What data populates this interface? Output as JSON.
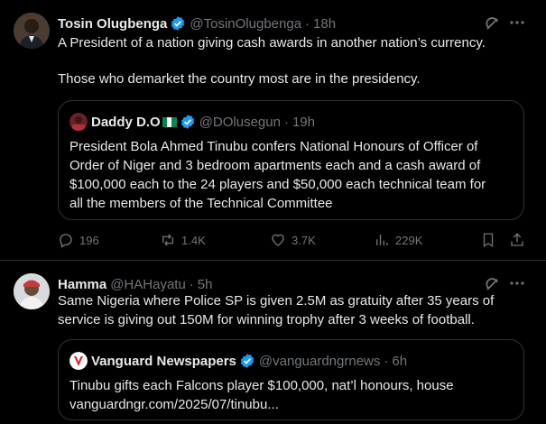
{
  "tweet1": {
    "name": "Tosin Olugbenga",
    "handle": "@TosinOlugbenga",
    "time": "18h",
    "line1": "A President of a nation giving cash awards in another nation’s currency.",
    "line2": "Those who demarket the country most are in the presidency.",
    "quote": {
      "name": "Daddy D.O",
      "handle": "@DOlusegun",
      "time": "19h",
      "lines": [
        "President Bola Ahmed Tinubu confers National Honours of Officer of",
        "Order of Niger and 3 bedroom apartments each and a cash award of",
        "$100,000 each to the 24 players and $50,000 each technical team for",
        "all the members of the Technical Committee"
      ]
    },
    "stats": {
      "replies": "196",
      "reposts": "1.4K",
      "likes": "3.7K",
      "views": "229K"
    }
  },
  "tweet2": {
    "name": "Hamma",
    "handle": "@HAHayatu",
    "time": "5h",
    "line1": "Same Nigeria where Police SP is given 2.5M as gratuity after 35 years of",
    "line2": "service is giving out 150M for winning trophy after 3 weeks of football.",
    "quote": {
      "name": "Vanguard Newspapers",
      "handle": "@vanguardngrnews",
      "time": "6h",
      "lines": [
        "Tinubu gifts each Falcons player $100,000, nat’l honours, house",
        "vanguardngr.com/2025/07/tinubu..."
      ]
    }
  },
  "colors": {
    "accent": "#1d9bf0",
    "muted": "#71767b",
    "border": "#2f3336",
    "background": "#000000"
  }
}
